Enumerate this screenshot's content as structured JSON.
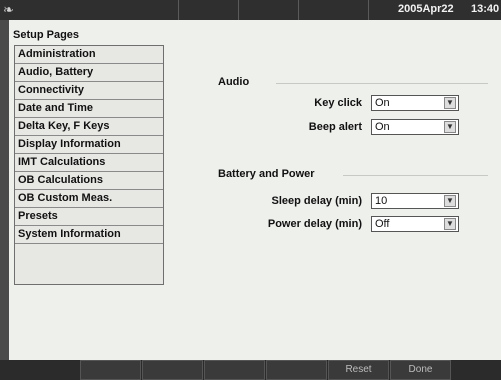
{
  "status_bar": {
    "icon_name": "app-swirl-icon",
    "date": "2005Apr22",
    "time": "13:40"
  },
  "setup": {
    "title": "Setup Pages",
    "items": [
      {
        "label": "Administration"
      },
      {
        "label": "Audio, Battery"
      },
      {
        "label": "Connectivity"
      },
      {
        "label": "Date and Time"
      },
      {
        "label": "Delta Key, F Keys"
      },
      {
        "label": "Display Information"
      },
      {
        "label": "IMT Calculations"
      },
      {
        "label": "OB Calculations"
      },
      {
        "label": "OB Custom Meas."
      },
      {
        "label": "Presets"
      },
      {
        "label": "System Information"
      }
    ]
  },
  "audio": {
    "title": "Audio",
    "key_click_label": "Key click",
    "key_click_value": "On",
    "beep_alert_label": "Beep alert",
    "beep_alert_value": "On"
  },
  "battery": {
    "title": "Battery and Power",
    "sleep_delay_label": "Sleep delay (min)",
    "sleep_delay_value": "10",
    "power_delay_label": "Power delay (min)",
    "power_delay_value": "Off"
  },
  "bottom_bar": {
    "reset_label": "Reset",
    "done_label": "Done"
  },
  "colors": {
    "panel_background": "#eef0ec",
    "chrome": "#2f2f2f"
  }
}
